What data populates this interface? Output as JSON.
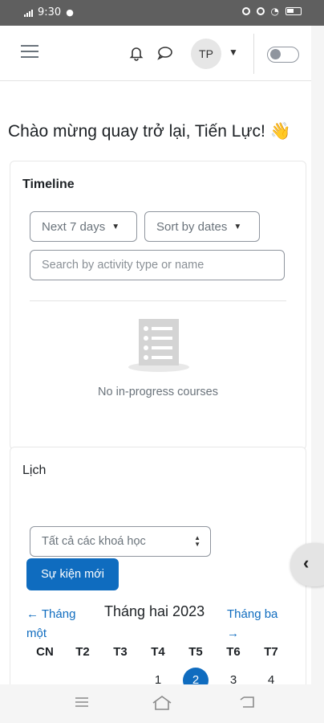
{
  "status_bar": {
    "time": "9:30"
  },
  "header": {
    "user_initials": "TP",
    "icons": [
      "menu-icon",
      "bell-icon",
      "chat-icon",
      "chevron-down-icon",
      "toggle-switch"
    ]
  },
  "greeting": "Chào mừng quay trở lại, Tiến Lực! 👋",
  "timeline": {
    "title": "Timeline",
    "range_select": "Next 7 days",
    "sort_select": "Sort by dates",
    "search_placeholder": "Search by activity type or name",
    "empty_text": "No in-progress courses"
  },
  "calendar": {
    "title": "Lịch",
    "course_select": "Tất cả các khoá học",
    "new_event_label": "Sự kiện mới",
    "prev_month": "← Tháng một",
    "current_month": "Tháng hai 2023",
    "next_month": "Tháng ba →",
    "weekdays": [
      "CN",
      "T2",
      "T3",
      "T4",
      "T5",
      "T6",
      "T7"
    ],
    "days": [
      "1",
      "2",
      "3",
      "4"
    ],
    "today": "2"
  },
  "colors": {
    "accent": "#0f6cbf",
    "status_bar": "#5f5f5f"
  }
}
